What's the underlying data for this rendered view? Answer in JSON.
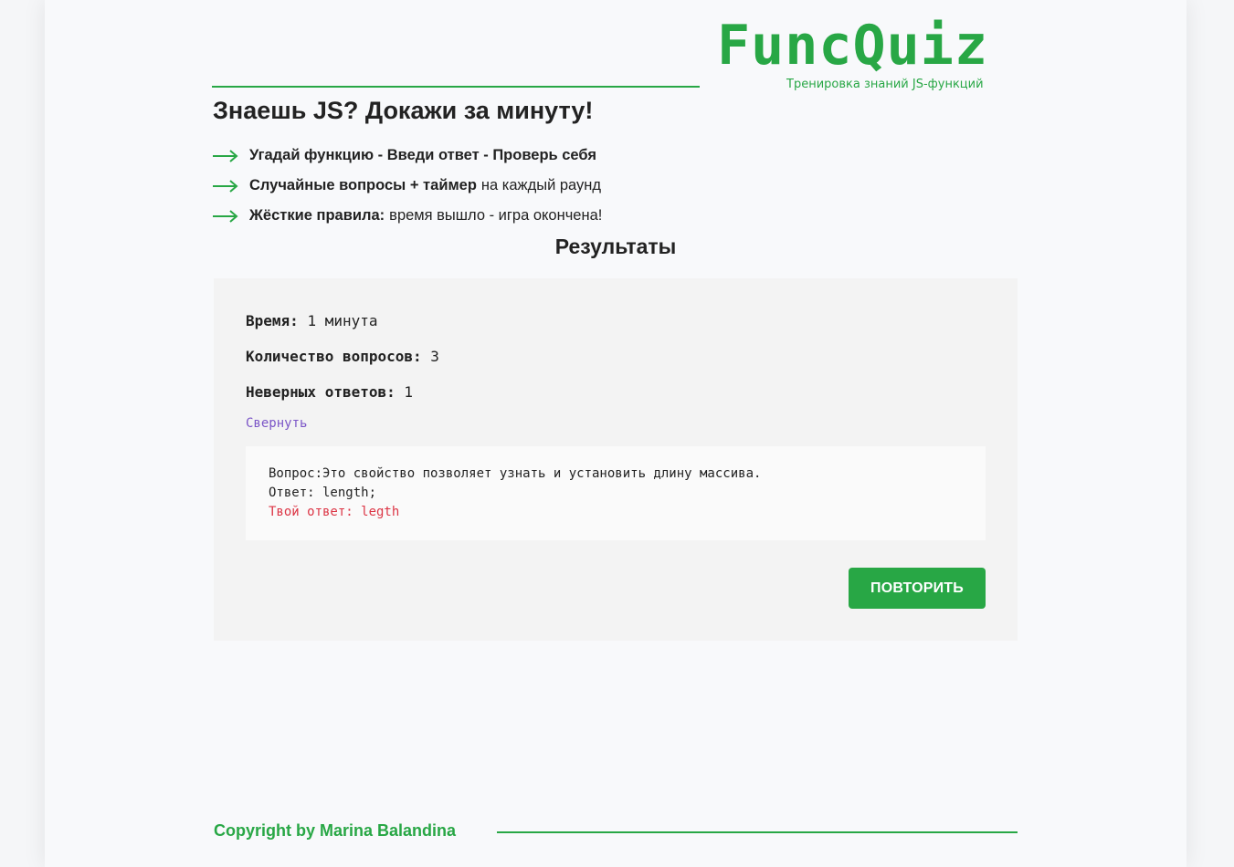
{
  "header": {
    "logo": "FuncQuiz",
    "tagline": "Тренировка знаний JS-функций"
  },
  "headline": "Знаешь JS? Докажи за минуту!",
  "features": [
    {
      "bold": "Угадай функцию - Введи ответ - Проверь себя",
      "text": ""
    },
    {
      "bold": "Случайные вопросы + таймер",
      "text": "на каждый раунд"
    },
    {
      "bold": "Жёсткие правила:",
      "text": "время вышло - игра окончена!"
    }
  ],
  "results": {
    "title": "Результаты",
    "time_label": "Время:",
    "time_value": "1 минута",
    "count_label": "Количество вопросов:",
    "count_value": "3",
    "wrong_label": "Неверных ответов:",
    "wrong_value": "1",
    "collapse_label": "Свернуть",
    "answer": {
      "question": "Вопрос:Это свойство позволяет узнать и установить длину массива.",
      "correct": "Ответ: length;",
      "yours": "Твой ответ: legth"
    },
    "retry_label": "ПОВТОРИТЬ"
  },
  "footer": {
    "copyright": "Copyright by Marina Balandina"
  },
  "colors": {
    "accent": "#28a745",
    "error": "#dc3545",
    "link": "#7b55c7"
  }
}
